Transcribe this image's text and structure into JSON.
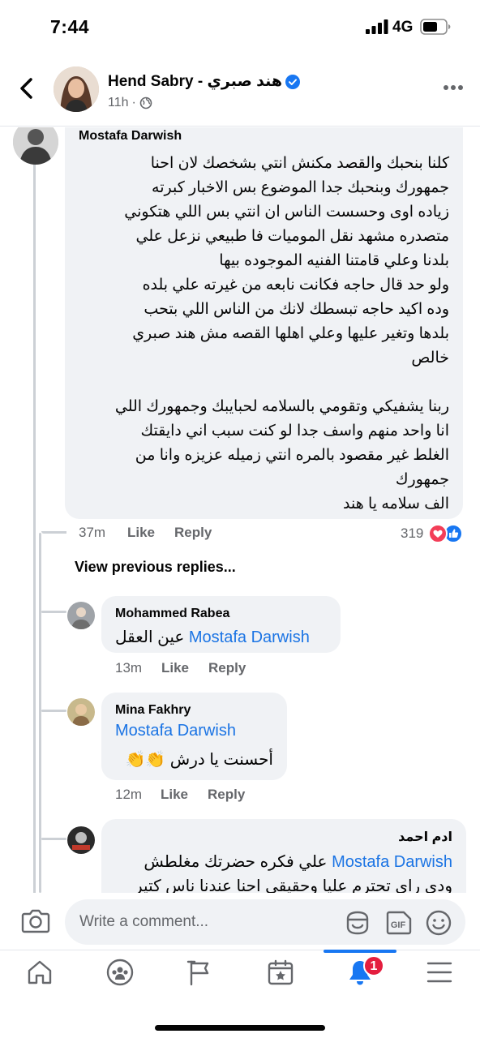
{
  "status_bar": {
    "time": "7:44",
    "network": "4G"
  },
  "post_header": {
    "page_name": "Hend Sabry - هند صبري",
    "timestamp": "11h",
    "separator": "·"
  },
  "comments": {
    "main": {
      "author": "Mostafa Darwish",
      "lines": [
        "كلنا بنحبك والقصد مكنش انتي بشخصك لان احنا",
        "جمهورك وبنحبك جدا الموضوع بس الاخبار كبرته",
        "زياده اوى وحسست الناس ان انتي بس اللي هتكوني",
        "متصدره مشهد نقل الموميات فا طبيعي نزعل علي",
        "بلدنا وعلي قامتنا الفنيه الموجوده بيها",
        "ولو حد قال حاجه فكانت نابعه من غيرته علي بلده",
        "وده اكيد حاجه تبسطك لانك من الناس اللي بتحب",
        "بلدها وتغير عليها وعلي اهلها القصه مش هند صبري",
        "خالص",
        "",
        "ربنا يشفيكي وتقومي بالسلامه لحبايبك وجمهورك اللي",
        "انا واحد منهم واسف جدا لو كنت سبب اني دايقتك",
        "الغلط غير مقصود بالمره انتي زميله عزيزه وانا من",
        "جمهورك",
        "الف سلامه يا هند"
      ],
      "time": "37m",
      "like_label": "Like",
      "reply_label": "Reply",
      "reaction_count": "319"
    },
    "view_previous": "View previous replies...",
    "replies": [
      {
        "author": "Mohammed Rabea",
        "mention": "Mostafa Darwish",
        "text": "عين العقل",
        "time": "13m",
        "like_label": "Like",
        "reply_label": "Reply"
      },
      {
        "author": "Mina Fakhry",
        "mention": "Mostafa Darwish",
        "text": "أحسنت يا درش 👏👏",
        "time": "12m",
        "like_label": "Like",
        "reply_label": "Reply"
      },
      {
        "author": "ادم احمد",
        "mention": "Mostafa Darwish",
        "text": "علي فكره حضرتك مغلطش",
        "text2": "ودى راى تحترم عليا وحقيقى احنا عندنا ناس كتير"
      }
    ]
  },
  "composer": {
    "placeholder": "Write a comment..."
  },
  "nav": {
    "notification_count": "1"
  },
  "colors": {
    "accent": "#1877f2",
    "mention": "#1b74e4",
    "badge": "#e41e3f",
    "bubble": "#f0f2f5"
  }
}
